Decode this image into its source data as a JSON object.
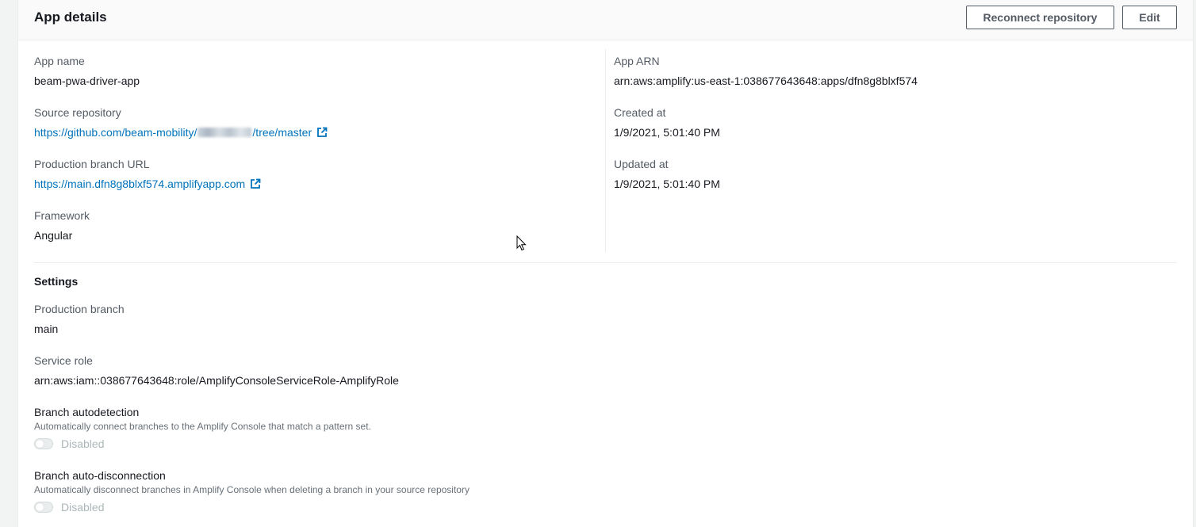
{
  "header": {
    "title": "App details",
    "reconnect_label": "Reconnect repository",
    "edit_label": "Edit"
  },
  "details": {
    "app_name": {
      "label": "App name",
      "value": "beam-pwa-driver-app"
    },
    "source_repository": {
      "label": "Source repository",
      "value_prefix": "https://github.com/beam-mobility/",
      "value_suffix": "/tree/master"
    },
    "production_branch_url": {
      "label": "Production branch URL",
      "value": "https://main.dfn8g8blxf574.amplifyapp.com"
    },
    "framework": {
      "label": "Framework",
      "value": "Angular"
    },
    "app_arn": {
      "label": "App ARN",
      "value": "arn:aws:amplify:us-east-1:038677643648:apps/dfn8g8blxf574"
    },
    "created_at": {
      "label": "Created at",
      "value": "1/9/2021, 5:01:40 PM"
    },
    "updated_at": {
      "label": "Updated at",
      "value": "1/9/2021, 5:01:40 PM"
    }
  },
  "settings": {
    "title": "Settings",
    "production_branch": {
      "label": "Production branch",
      "value": "main"
    },
    "service_role": {
      "label": "Service role",
      "value": "arn:aws:iam::038677643648:role/AmplifyConsoleServiceRole-AmplifyRole"
    },
    "branch_autodetection": {
      "label": "Branch autodetection",
      "description": "Automatically connect branches to the Amplify Console that match a pattern set.",
      "state": "Disabled"
    },
    "branch_autodisconnection": {
      "label": "Branch auto-disconnection",
      "description": "Automatically disconnect branches in Amplify Console when deleting a branch in your source repository",
      "state": "Disabled"
    }
  },
  "icons": {
    "external_link": "external-link-icon",
    "cursor": "mouse-cursor-icon"
  },
  "colors": {
    "link": "#0073bb",
    "label": "#545b64",
    "text": "#16191f",
    "disabled": "#aab7b8"
  }
}
